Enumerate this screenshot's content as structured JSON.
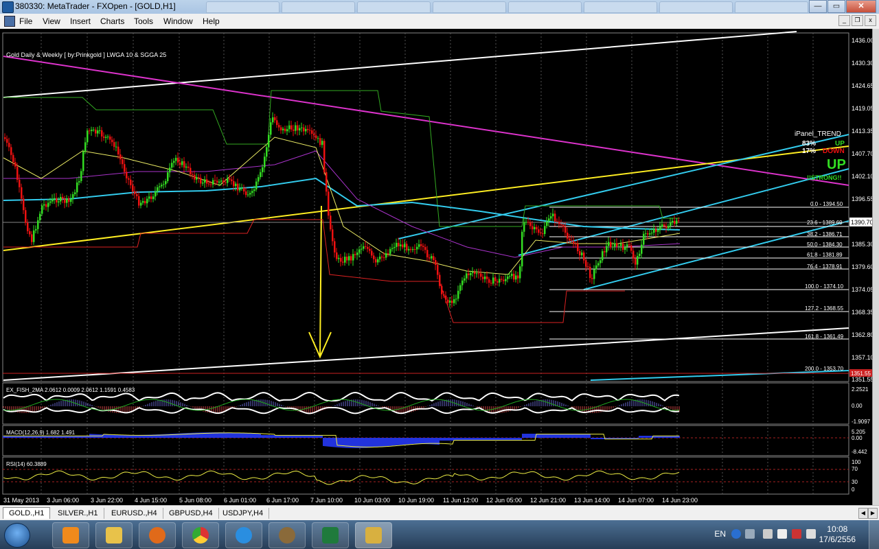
{
  "window": {
    "title": "380330: MetaTrader - FXOpen - [GOLD,H1]"
  },
  "menu": {
    "items": [
      "File",
      "View",
      "Insert",
      "Charts",
      "Tools",
      "Window",
      "Help"
    ]
  },
  "chart": {
    "title": "Gold Daily & Weekly [ by:Prinkgold ] LWGA 10  &  SGGA 25",
    "price_axis": [
      "1436.00",
      "1430.30",
      "1424.65",
      "1419.05",
      "1413.35",
      "1407.70",
      "1402.10",
      "1396.55",
      "1390.70",
      "1385.30",
      "1379.60",
      "1374.05",
      "1368.35",
      "1362.80",
      "1357.10",
      "1351.55"
    ],
    "current_price": "1390.70",
    "bottom_price_tag": "1351.55",
    "time_axis": [
      "31 May 2013",
      "3 Jun 06:00",
      "3 Jun 22:00",
      "4 Jun 15:00",
      "5 Jun 08:00",
      "6 Jun 01:00",
      "6 Jun 17:00",
      "7 Jun 10:00",
      "10 Jun 03:00",
      "10 Jun 19:00",
      "11 Jun 12:00",
      "12 Jun 05:00",
      "12 Jun 21:00",
      "13 Jun 14:00",
      "14 Jun 07:00",
      "14 Jun 23:00"
    ],
    "fib_levels": [
      "0.0 - 1394.50",
      "23.6 - 1389.69",
      "38.2 - 1386.71",
      "50.0 - 1384.30",
      "61.8 - 1381.89",
      "76.4 - 1378.91",
      "100.0 - 1374.10",
      "127.2 - 1368.55",
      "161.8 - 1361.49",
      "200.0 - 1353.70"
    ],
    "ipanel": {
      "title": "iPanel_TREND",
      "up_pct": "83%",
      "up_label": "UP",
      "down_pct": "17%",
      "down_label": "DOWN",
      "big": "UP",
      "strong": "!!STRONG!!"
    },
    "colors": {
      "bull": "#33dd22",
      "bear": "#ee1111",
      "fib": "#ffffff",
      "channel": "#33ccee",
      "trend_yellow": "#ffee22",
      "trend_magenta": "#dd33cc",
      "ma_cyan": "#33ccee"
    }
  },
  "indicators": {
    "fish": {
      "label": "EX_FISH_2MA 2.0612 0.0009 2.0612 1.1591 0.4583",
      "axis": [
        "2.2521",
        "0.00",
        "-1.9097"
      ]
    },
    "macd": {
      "label": "MACD(12,26,9) 1.682 1.491",
      "axis": [
        "5.205",
        "0.00",
        "-8.442"
      ]
    },
    "rsi": {
      "label": "RSI(14) 60.3889",
      "axis": [
        "100",
        "70",
        "30",
        "0"
      ]
    }
  },
  "bottom_tabs": [
    "GOLD.,H1",
    "SILVER.,H1",
    "EURUSD.,H4",
    "GBPUSD,H4",
    "USDJPY,H4"
  ],
  "taskbar": {
    "lang": "EN",
    "time": "10:08",
    "date": "17/6/2556"
  }
}
